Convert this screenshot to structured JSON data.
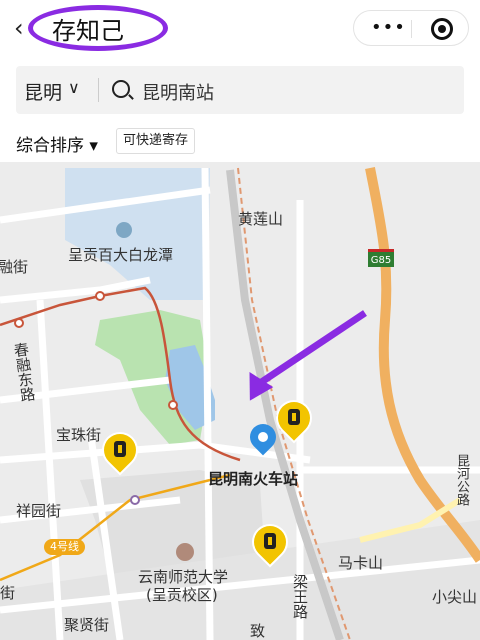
{
  "header": {
    "back_icon": "chevron-left-icon",
    "title": "存知己",
    "more_icon": "more-dots-icon",
    "more_label": "•••",
    "target_icon": "target-icon"
  },
  "search": {
    "city": "昆明",
    "city_chevron": "∨",
    "query": "昆明南站",
    "search_icon": "search-icon"
  },
  "filters": {
    "sort_label": "综合排序 ▾",
    "tag_label": "可快递寄存"
  },
  "map": {
    "labels": {
      "huanglianshan": "黄莲山",
      "bailongtan": "呈贡百大白龙潭",
      "g85": "G85",
      "rongjie": "融街",
      "chunrong": "春融东路",
      "baozhu": "宝珠街",
      "xiangyuan": "祥园街",
      "station": "昆明南火车站",
      "metro4": "4号线",
      "university": "云南师范大学",
      "university_campus": "(呈贡校区)",
      "liangwang": "梁王路",
      "makashan": "马卡山",
      "xiaojianshan": "小尖山",
      "juxian": "聚贤街",
      "zhi": "致",
      "jie": "街",
      "side_road": "昆河公路"
    }
  },
  "colors": {
    "accent": "#8a2be2",
    "pin_yellow": "#f2c400",
    "location_blue": "#2f8ee0"
  }
}
